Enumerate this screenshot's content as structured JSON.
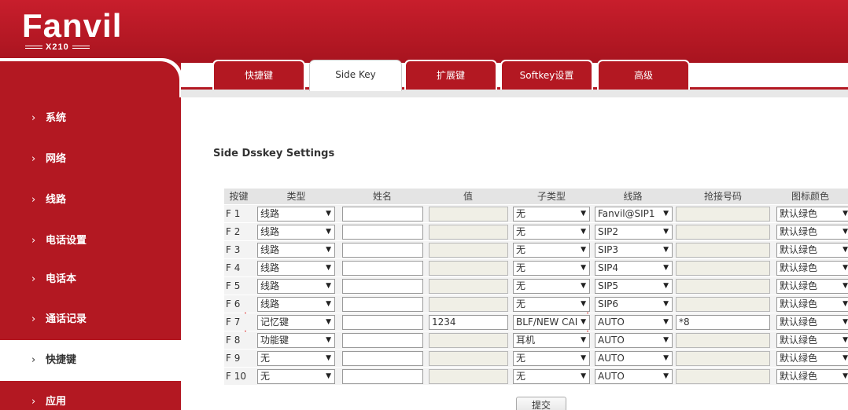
{
  "brand": {
    "logo": "Fanvil",
    "model": "X210"
  },
  "sidebar": {
    "items": [
      {
        "label": "系统",
        "active": false
      },
      {
        "label": "网络",
        "active": false
      },
      {
        "label": "线路",
        "active": false
      },
      {
        "label": "电话设置",
        "active": false
      },
      {
        "label": "电话本",
        "active": false
      },
      {
        "label": "通话记录",
        "active": false
      },
      {
        "label": "快捷键",
        "active": true
      },
      {
        "label": "应用",
        "active": false
      }
    ]
  },
  "tabs": [
    {
      "label": "快捷键",
      "active": false
    },
    {
      "label": "Side Key",
      "active": true
    },
    {
      "label": "扩展键",
      "active": false
    },
    {
      "label": "Softkey设置",
      "active": false
    },
    {
      "label": "高级",
      "active": false
    }
  ],
  "section": {
    "title": "Side Dsskey Settings"
  },
  "table": {
    "headers": [
      "按键",
      "类型",
      "姓名",
      "值",
      "子类型",
      "线路",
      "抢接号码",
      "图标颜色"
    ],
    "rows": [
      {
        "key": "F 1",
        "type": "线路",
        "name": "",
        "value": "",
        "subtype": "无",
        "line": "Fanvil@SIP1",
        "pickup": "",
        "color": "默认绿色"
      },
      {
        "key": "F 2",
        "type": "线路",
        "name": "",
        "value": "",
        "subtype": "无",
        "line": "SIP2",
        "pickup": "",
        "color": "默认绿色"
      },
      {
        "key": "F 3",
        "type": "线路",
        "name": "",
        "value": "",
        "subtype": "无",
        "line": "SIP3",
        "pickup": "",
        "color": "默认绿色"
      },
      {
        "key": "F 4",
        "type": "线路",
        "name": "",
        "value": "",
        "subtype": "无",
        "line": "SIP4",
        "pickup": "",
        "color": "默认绿色"
      },
      {
        "key": "F 5",
        "type": "线路",
        "name": "",
        "value": "",
        "subtype": "无",
        "line": "SIP5",
        "pickup": "",
        "color": "默认绿色"
      },
      {
        "key": "F 6",
        "type": "线路",
        "name": "",
        "value": "",
        "subtype": "无",
        "line": "SIP6",
        "pickup": "",
        "color": "默认绿色"
      },
      {
        "key": "F 7",
        "type": "记忆键",
        "name": "",
        "value": "1234",
        "subtype": "BLF/NEW CAI",
        "line": "AUTO",
        "pickup": "*8",
        "color": "默认绿色"
      },
      {
        "key": "F 8",
        "type": "功能键",
        "name": "",
        "value": "",
        "subtype": "耳机",
        "line": "AUTO",
        "pickup": "",
        "color": "默认绿色"
      },
      {
        "key": "F 9",
        "type": "无",
        "name": "",
        "value": "",
        "subtype": "无",
        "line": "AUTO",
        "pickup": "",
        "color": "默认绿色"
      },
      {
        "key": "F 10",
        "type": "无",
        "name": "",
        "value": "",
        "subtype": "无",
        "line": "AUTO",
        "pickup": "",
        "color": "默认绿色"
      }
    ]
  },
  "buttons": {
    "submit": "提交"
  },
  "colors": {
    "brand_red": "#b31822",
    "highlight": "#e02a2a"
  }
}
